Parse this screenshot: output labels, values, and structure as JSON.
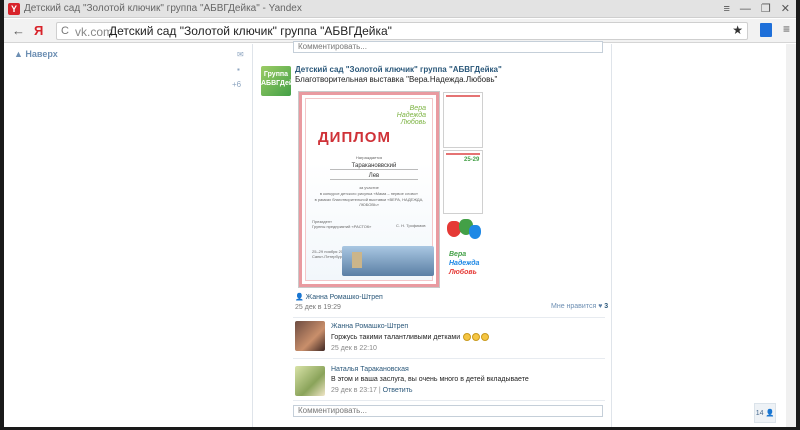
{
  "browser": {
    "window_title": "Детский сад \"Золотой ключик\" группа \"АБВГДейка\" - Yandex",
    "ya_letter": "Y",
    "win_controls": {
      "menu": "≡",
      "minimize": "—",
      "maximize": "❐",
      "close": "✕"
    },
    "back": "←",
    "ya_home": "Я",
    "refresh": "C",
    "domain": "vk.com",
    "address_title": "Детский сад \"Золотой ключик\" группа \"АБВГДейка\"",
    "star": "★",
    "menu": "≡"
  },
  "left": {
    "naverh": "▲ Наверх",
    "mail_icon": "✉",
    "msg_icon": "▪",
    "plus_count": "+6"
  },
  "feed": {
    "comment_placeholder_top": "Комментировать...",
    "post": {
      "avatar_text": "Группа\nАБВГДейка",
      "author": "Детский сад \"Золотой ключик\" группа \"АБВГДейка\"",
      "text": "Благотворительная выставка \"Вера.Надежда.Любовь\"",
      "diploma": {
        "logo": "Вера Надежда Любовь",
        "title": "ДИПЛОМ",
        "awarded": "Награждается",
        "name1": "Таракановвский",
        "name2": "Лев",
        "line1": "за участие",
        "line2": "в конкурсе детского рисунка «Мама – первое слово»",
        "line3": "в рамках благотворительной выставки «ВЕРА, НАДЕЖДА, ЛЮБОВЬ»",
        "president": "Президент\nГруппы предприятий «РАСТОК»",
        "signer": "С. Н. Трофимов",
        "date": "25–29 ноября 2015\nСанкт-Петербург"
      },
      "thumb_date": "25-29",
      "hands_text": [
        "Вера",
        "Надежда",
        "Любовь"
      ],
      "liker": "Жанна Ромашко-Штреп",
      "date": "25 дек в 19:29",
      "likes_label": "Мне нравится",
      "likes_count": "3"
    },
    "comments": [
      {
        "author": "Жанна Ромашко-Штреп",
        "text": "Горжусь такими талантливыми детками",
        "time": "25 дек в 22:10",
        "reply": ""
      },
      {
        "author": "Наталья Таракановская",
        "text": "В этом и ваша заслуга, вы очень много в детей вкладываете",
        "time": "29 дек в 23:17",
        "reply": "Ответить"
      }
    ],
    "comment_placeholder_bottom": "Комментировать..."
  },
  "counter": "14 👤"
}
